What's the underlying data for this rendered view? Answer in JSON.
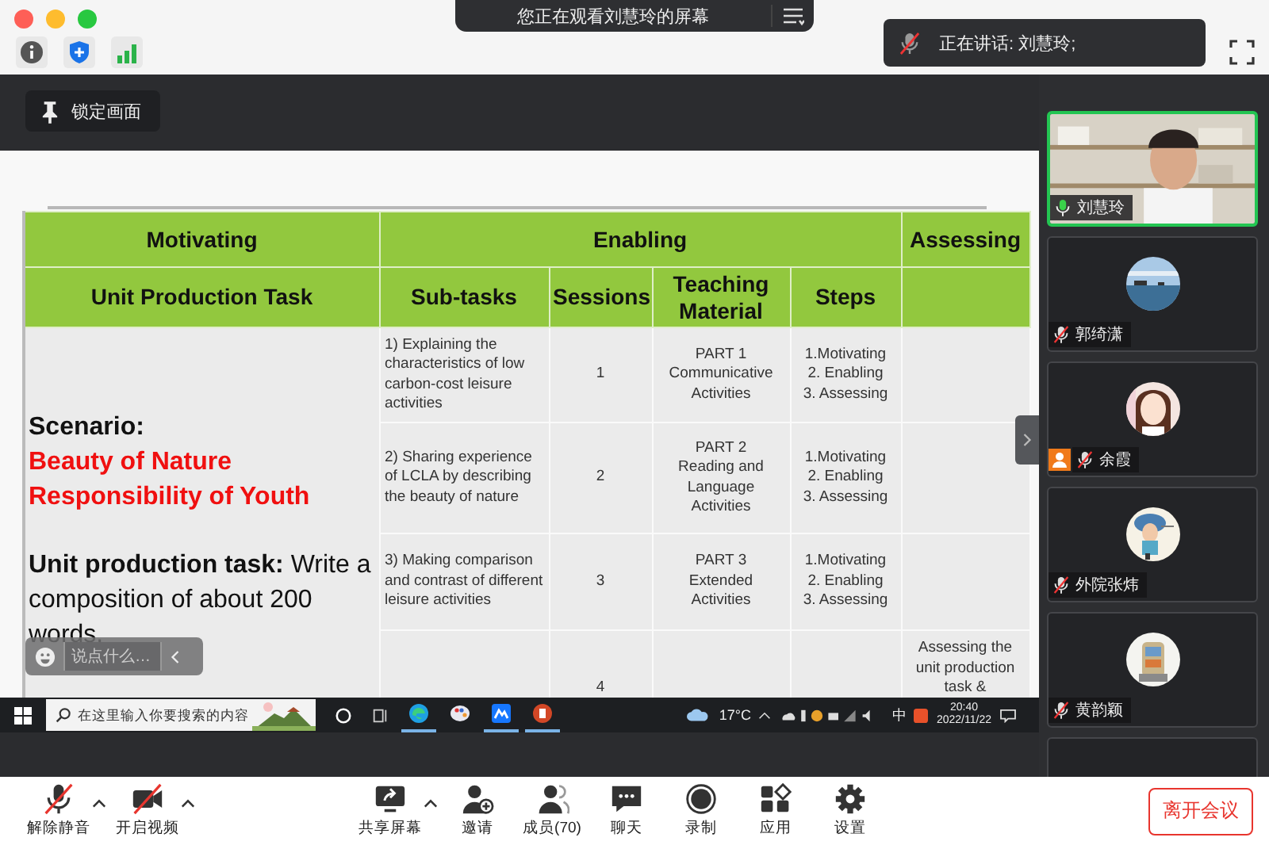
{
  "window": {
    "title": "您正在观看刘慧玲的屏幕"
  },
  "speaker_notice": {
    "text": "正在讲话: 刘慧玲;"
  },
  "lock_view_button": "锁定画面",
  "slide_table": {
    "group_headers": [
      "Motivating",
      "Enabling",
      "Assessing"
    ],
    "columns": [
      "Unit Production Task",
      "Sub-tasks",
      "Sessions",
      "Teaching Material",
      "Steps"
    ],
    "scenario": {
      "label": "Scenario:",
      "highlights": [
        "Beauty of Nature",
        "Responsibility of Youth"
      ],
      "task": "**Unit production task:** Write a composition of about 200 words."
    },
    "rows": [
      {
        "subtask": "1) Explaining the characteristics of low carbon-cost leisure activities",
        "session": "1",
        "material": "PART 1\nCommunicative\nActivities",
        "steps": "1.Motivating\n2. Enabling\n3. Assessing"
      },
      {
        "subtask": "2) Sharing experience of LCLA by describing the beauty of nature",
        "session": "2",
        "material": "PART 2\nReading and\nLanguage\nActivities",
        "steps": "1.Motivating\n2. Enabling\n3. Assessing"
      },
      {
        "subtask": "3) Making comparison and contrast of different leisure activities",
        "session": "3",
        "material": "PART 3\nExtended\nActivities",
        "steps": "1.Motivating\n2. Enabling\n3. Assessing"
      },
      {
        "session": "4",
        "assessing": "Assessing the unit production task &"
      }
    ]
  },
  "chat_input": {
    "placeholder": "说点什么…"
  },
  "taskbar": {
    "search_placeholder": "在这里输入你要搜索的内容",
    "apps": [
      {
        "kind": "browser",
        "running": true
      },
      {
        "kind": "paint",
        "running": false
      },
      {
        "kind": "meeting",
        "running": true
      },
      {
        "kind": "slides",
        "running": true
      }
    ],
    "weather": "17°C",
    "ime": "中",
    "time": "20:40",
    "date": "2022/11/22"
  },
  "participants": [
    {
      "name": "刘慧玲",
      "video": true,
      "muted": false,
      "speaking": true,
      "person_badge": false
    },
    {
      "name": "郭绮潇",
      "video": false,
      "muted": true,
      "speaking": false,
      "person_badge": false
    },
    {
      "name": "余霞",
      "video": false,
      "muted": true,
      "speaking": false,
      "person_badge": true
    },
    {
      "name": "外院张炜",
      "video": false,
      "muted": true,
      "speaking": false,
      "person_badge": false
    },
    {
      "name": "黄韵颖",
      "video": false,
      "muted": true,
      "speaking": false,
      "person_badge": false
    }
  ],
  "toolbar": [
    {
      "kind": "mic",
      "label": "解除静音",
      "caret": true,
      "off": true
    },
    {
      "kind": "video",
      "label": "开启视频",
      "caret": true,
      "off": true
    },
    {
      "kind": "share",
      "label": "共享屏幕",
      "caret": true,
      "off": false
    },
    {
      "kind": "invite",
      "label": "邀请",
      "caret": false,
      "off": false
    },
    {
      "kind": "members",
      "label": "成员(70)",
      "caret": false,
      "off": false
    },
    {
      "kind": "chat",
      "label": "聊天",
      "caret": false,
      "off": false
    },
    {
      "kind": "record",
      "label": "录制",
      "caret": false,
      "off": false
    },
    {
      "kind": "apps",
      "label": "应用",
      "caret": false,
      "off": false
    },
    {
      "kind": "settings",
      "label": "设置",
      "caret": false,
      "off": false
    }
  ],
  "leave_button": "离开会议"
}
